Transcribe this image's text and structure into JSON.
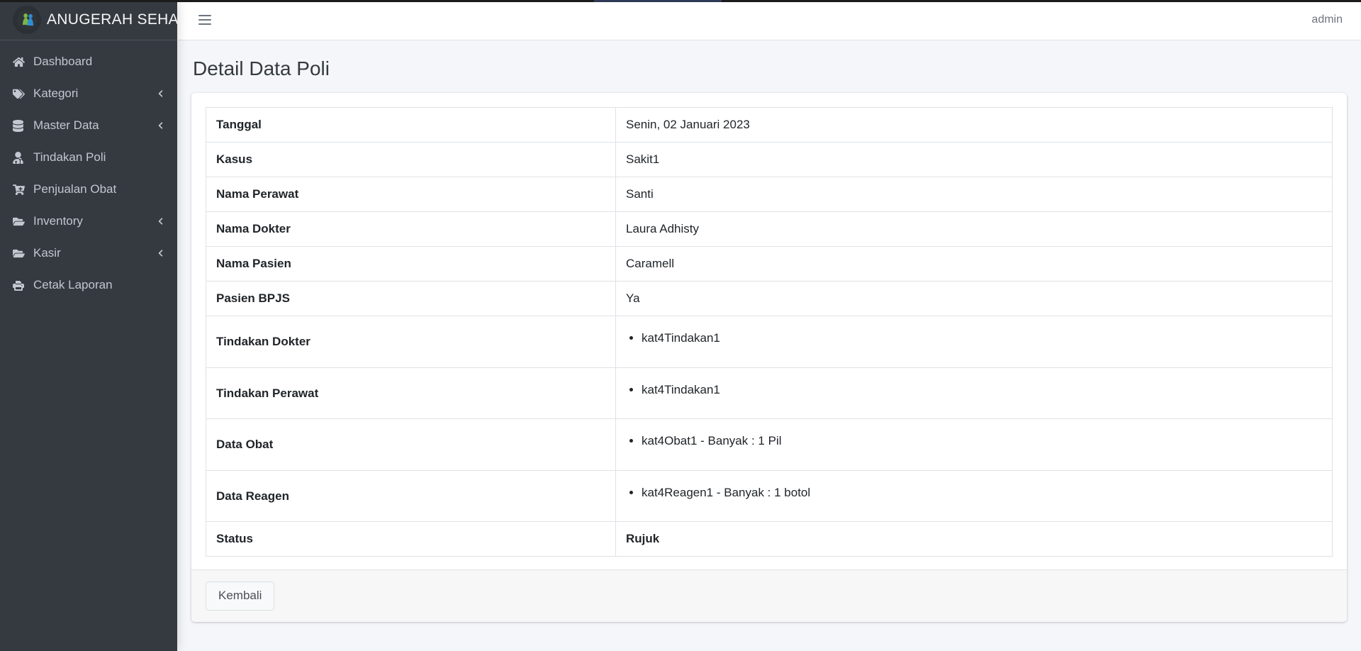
{
  "brand": {
    "title": "ANUGERAH SEHAT",
    "logo_icon": "people-care-logo-icon"
  },
  "sidebar": {
    "items": [
      {
        "label": "Dashboard",
        "icon": "home-icon",
        "arrow": false
      },
      {
        "label": "Kategori",
        "icon": "tags-icon",
        "arrow": true
      },
      {
        "label": "Master Data",
        "icon": "database-icon",
        "arrow": true
      },
      {
        "label": "Tindakan Poli",
        "icon": "user-md-icon",
        "arrow": false
      },
      {
        "label": "Penjualan Obat",
        "icon": "shopping-cart-icon",
        "arrow": false
      },
      {
        "label": "Inventory",
        "icon": "folder-open-icon",
        "arrow": true
      },
      {
        "label": "Kasir",
        "icon": "folder-open-icon",
        "arrow": true
      },
      {
        "label": "Cetak Laporan",
        "icon": "print-icon",
        "arrow": false
      }
    ],
    "arrow_icon": "chevron-left-icon"
  },
  "header": {
    "menu_icon": "hamburger-menu-icon",
    "user": "admin"
  },
  "main": {
    "page_title": "Detail Data Poli",
    "rows": [
      {
        "label": "Tanggal",
        "value": "Senin, 02 Januari 2023",
        "type": "text"
      },
      {
        "label": "Kasus",
        "value": "Sakit1",
        "type": "text"
      },
      {
        "label": "Nama Perawat",
        "value": "Santi",
        "type": "text"
      },
      {
        "label": "Nama Dokter",
        "value": "Laura Adhisty",
        "type": "text"
      },
      {
        "label": "Nama Pasien",
        "value": "Caramell",
        "type": "text"
      },
      {
        "label": "Pasien BPJS",
        "value": "Ya",
        "type": "text"
      },
      {
        "label": "Tindakan Dokter",
        "items": [
          "kat4Tindakan1"
        ],
        "type": "list"
      },
      {
        "label": "Tindakan Perawat",
        "items": [
          "kat4Tindakan1"
        ],
        "type": "list"
      },
      {
        "label": "Data Obat",
        "items": [
          "kat4Obat1 - Banyak : 1 Pil"
        ],
        "type": "list"
      },
      {
        "label": "Data Reagen",
        "items": [
          "kat4Reagen1 - Banyak : 1 botol"
        ],
        "type": "list"
      },
      {
        "label": "Status",
        "value": "Rujuk",
        "type": "bold"
      }
    ],
    "back_button": "Kembali"
  },
  "colors": {
    "sidebar_bg": "#343a40",
    "page_bg": "#f4f6f9",
    "card_bg": "#ffffff",
    "border": "#dee2e6",
    "text": "#212529",
    "muted": "#6c757d"
  }
}
